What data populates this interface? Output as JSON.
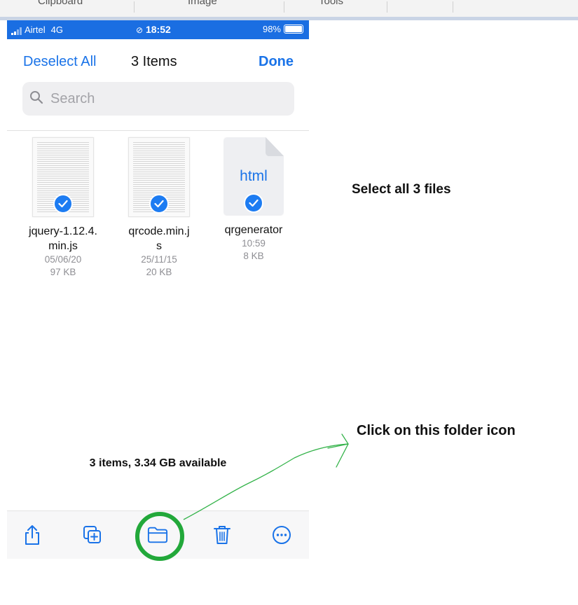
{
  "ribbon": {
    "tabs": [
      "Clipboard",
      "Image",
      "Tools"
    ]
  },
  "status_bar": {
    "carrier": "Airtel",
    "network": "4G",
    "time": "18:52",
    "battery": "98%"
  },
  "nav": {
    "left_label": "Deselect All",
    "title": "3 Items",
    "right_label": "Done"
  },
  "search": {
    "placeholder": "Search"
  },
  "files": [
    {
      "name": "jquery-1.12.4.min.js",
      "date": "05/06/20",
      "size": "97 KB",
      "selected": true
    },
    {
      "name": "qrcode.min.js",
      "date": "25/11/15",
      "size": "20 KB",
      "selected": true
    },
    {
      "name": "qrgenerator",
      "date": "10:59",
      "size": "8 KB",
      "selected": true,
      "ext": "html"
    }
  ],
  "storage_text": "3 items, 3.34 GB available",
  "toolbar": {
    "items": [
      "share-icon",
      "duplicate-icon",
      "folder-icon",
      "trash-icon",
      "more-icon"
    ]
  },
  "annotations": {
    "select_note": "Select all 3 files",
    "click_note": "Click on this folder icon"
  },
  "colors": {
    "accent": "#1a73e8",
    "status_bar": "#1a6ee2",
    "highlight": "#22a83a"
  }
}
